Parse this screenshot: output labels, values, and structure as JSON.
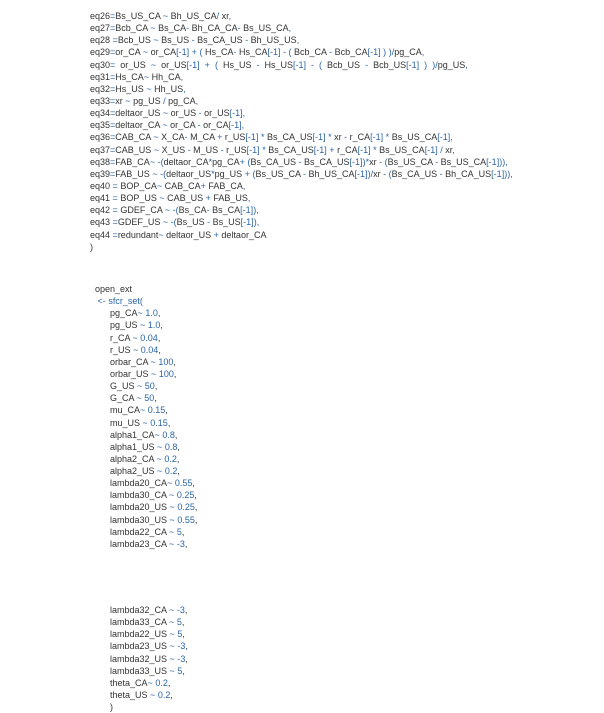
{
  "eq_block": {
    "lines": [
      {
        "name": "eq26",
        "text": "=Bs_US_CA ~ Bh_US_CA/ xr,"
      },
      {
        "name": "eq27",
        "text": "=Bcb_CA ~ Bs_CA- Bh_CA_CA- Bs_US_CA,"
      },
      {
        "name": "eq28",
        "text": " =Bcb_US ~ Bs_US - Bs_CA_US - Bh_US_US,"
      },
      {
        "name": "eq29",
        "text": "=or_CA ~ or_CA[-1] + ( Hs_CA- Hs_CA[-1] - ( Bcb_CA - Bcb_CA[-1] ) )/pg_CA,"
      },
      {
        "name": "eq30",
        "text": "=  or_US  ~  or_US[-1]  +  (  Hs_US  -  Hs_US[-1]  -  (  Bcb_US  -  Bcb_US[-1]  )  )/pg_US,"
      },
      {
        "name": "eq31",
        "text": "=Hs_CA~ Hh_CA,"
      },
      {
        "name": "eq32",
        "text": "=Hs_US ~ Hh_US,"
      },
      {
        "name": "eq33",
        "text": "=xr ~ pg_US / pg_CA,"
      },
      {
        "name": "eq34",
        "text": "=deltaor_US ~ or_US - or_US[-1],"
      },
      {
        "name": "eq35",
        "text": "=deltaor_CA ~ or_CA - or_CA[-1],"
      },
      {
        "name": "eq36",
        "text": "=CAB_CA ~ X_CA- M_CA + r_US[-1] * Bs_CA_US[-1] * xr - r_CA[-1] * Bs_US_CA[-1],"
      },
      {
        "name": "eq37",
        "text": "=CAB_US ~ X_US - M_US - r_US[-1] * Bs_CA_US[-1] + r_CA[-1] * Bs_US_CA[-1] / xr,"
      },
      {
        "name": "eq38",
        "text": "=FAB_CA~ -(deltaor_CA*pg_CA+ (Bs_CA_US - Bs_CA_US[-1])*xr - (Bs_US_CA - Bs_US_CA[-1])),"
      },
      {
        "name": "eq39",
        "text": "=FAB_US ~ -(deltaor_US*pg_US + (Bs_US_CA - Bh_US_CA[-1])/xr - (Bs_CA_US - Bh_CA_US[-1])),"
      },
      {
        "name": "eq40",
        "text": " = BOP_CA~ CAB_CA+ FAB_CA,"
      },
      {
        "name": "eq41",
        "text": " = BOP_US ~ CAB_US + FAB_US,"
      },
      {
        "name": "eq42",
        "text": " = GDEF_CA ~ -(Bs_CA- Bs_CA[-1]),"
      },
      {
        "name": "eq43",
        "text": " =GDEF_US ~ -(Bs_US - Bs_US[-1]),"
      },
      {
        "name": "eq44",
        "text": " =redundant~ deltaor_US + deltaor_CA"
      }
    ],
    "closing_paren": ")"
  },
  "open_ext": {
    "assign_left": "open_ext",
    "assign_op": "<-",
    "fn_call": "sfcr_set(",
    "params": [
      {
        "key": "pg_CA",
        "op": "~",
        "val": "1.0",
        "comma": ","
      },
      {
        "key": "pg_US",
        "op": "~",
        "val": "1.0",
        "comma": ","
      },
      {
        "key": "r_CA",
        "op": "~",
        "val": "0.04",
        "comma": ","
      },
      {
        "key": "r_US",
        "op": "~",
        "val": "0.04",
        "comma": ","
      },
      {
        "key": "orbar_CA",
        "op": "~",
        "val": "100",
        "comma": ","
      },
      {
        "key": "orbar_US",
        "op": "~",
        "val": "100",
        "comma": ","
      },
      {
        "key": "G_US",
        "op": "~",
        "val": "50",
        "comma": ","
      },
      {
        "key": "G_CA",
        "op": "~",
        "val": "50",
        "comma": ","
      },
      {
        "key": "mu_CA",
        "op": "~",
        "val": "0.15",
        "comma": ","
      },
      {
        "key": "mu_US",
        "op": "~",
        "val": "0.15",
        "comma": ","
      },
      {
        "key": "alpha1_CA",
        "op": "~",
        "val": "0.8",
        "comma": ","
      },
      {
        "key": "alpha1_US",
        "op": "~",
        "val": "0.8",
        "comma": ","
      },
      {
        "key": "alpha2_CA",
        "op": "~",
        "val": "0.2",
        "comma": ","
      },
      {
        "key": "alpha2_US",
        "op": "~",
        "val": "0.2",
        "comma": ","
      },
      {
        "key": "lambda20_CA",
        "op": "~",
        "val": "0.55",
        "comma": ","
      },
      {
        "key": "lambda30_CA",
        "op": "~",
        "val": "0.25",
        "comma": ","
      },
      {
        "key": "lambda20_US",
        "op": "~",
        "val": "0.25",
        "comma": ","
      },
      {
        "key": "lambda30_US",
        "op": "~",
        "val": "0.55",
        "comma": ","
      },
      {
        "key": "lambda22_CA",
        "op": "~",
        "val": "5",
        "comma": ","
      },
      {
        "key": "lambda23_CA",
        "op": "~",
        "val": "-3",
        "comma": ","
      }
    ],
    "params2": [
      {
        "key": "lambda32_CA",
        "op": "~",
        "val": "-3",
        "comma": ","
      },
      {
        "key": "lambda33_CA",
        "op": "~",
        "val": "5",
        "comma": ","
      },
      {
        "key": "lambda22_US",
        "op": "~",
        "val": "5",
        "comma": ","
      },
      {
        "key": "lambda23_US",
        "op": "~",
        "val": "-3",
        "comma": ","
      },
      {
        "key": "lambda32_US",
        "op": "~",
        "val": "-3",
        "comma": ","
      },
      {
        "key": "lambda33_US",
        "op": "~",
        "val": "5",
        "comma": ","
      },
      {
        "key": "theta_CA",
        "op": "~",
        "val": "0.2",
        "comma": ","
      },
      {
        "key": "theta_US",
        "op": "~",
        "val": "0.2",
        "comma": ","
      }
    ],
    "closing_paren": ")"
  }
}
